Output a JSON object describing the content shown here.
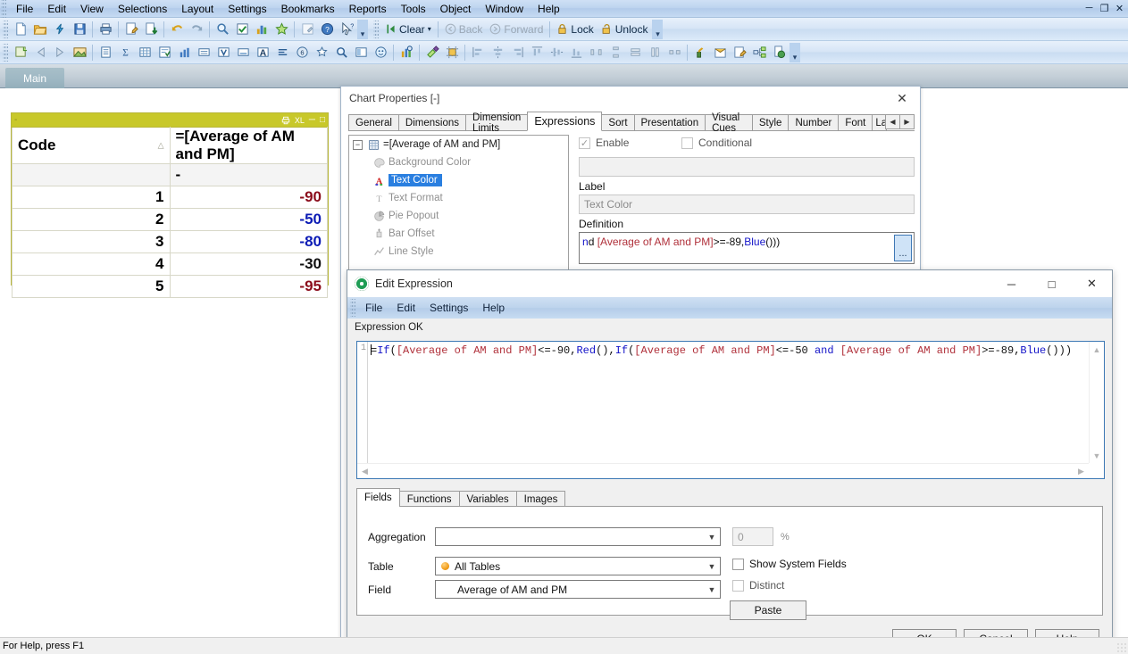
{
  "app": {
    "menu": [
      "File",
      "Edit",
      "View",
      "Selections",
      "Layout",
      "Settings",
      "Bookmarks",
      "Reports",
      "Tools",
      "Object",
      "Window",
      "Help"
    ],
    "window_controls": [
      "minimize-icon",
      "restore-icon",
      "close-icon"
    ],
    "sheet_tab": "Main",
    "status_text": "For Help, press F1",
    "toolbar_nav": {
      "clear": "Clear",
      "back": "Back",
      "forward": "Forward",
      "lock": "Lock",
      "unlock": "Unlock"
    }
  },
  "table_object": {
    "caption_title": "-",
    "caption_icons": [
      "print-icon",
      "XL",
      "minimize-icon",
      "maximize-icon"
    ],
    "columns": [
      "Code",
      "=[Average of AM and PM]"
    ],
    "total_row": [
      "",
      "-"
    ],
    "rows": [
      {
        "code": "1",
        "value": "-90",
        "color": "#8b0c1b"
      },
      {
        "code": "2",
        "value": "-50",
        "color": "#0b1bb5"
      },
      {
        "code": "3",
        "value": "-80",
        "color": "#0b1bb5"
      },
      {
        "code": "4",
        "value": "-30",
        "color": "#111111"
      },
      {
        "code": "5",
        "value": "-95",
        "color": "#8b0c1b"
      }
    ],
    "caption_color": "#c8c82a"
  },
  "chart_properties": {
    "title": "Chart Properties [-]",
    "close_label": "✕",
    "tabs": [
      "General",
      "Dimensions",
      "Dimension Limits",
      "Expressions",
      "Sort",
      "Presentation",
      "Visual Cues",
      "Style",
      "Number",
      "Font",
      "La"
    ],
    "active_tab": "Expressions",
    "spinners": [
      "◀",
      "▶"
    ],
    "tree": {
      "root": "=[Average of AM and PM]",
      "children": [
        "Background Color",
        "Text Color",
        "Text Format",
        "Pie Popout",
        "Bar Offset",
        "Line Style"
      ],
      "selected": "Text Color"
    },
    "enable_label": "Enable",
    "enable_checked": true,
    "conditional_label": "Conditional",
    "conditional_checked": false,
    "conditional_value": "",
    "label_caption": "Label",
    "label_value": "Text Color",
    "definition_caption": "Definition",
    "definition_visible_text": "nd [Average of AM and PM]>=-89,Blue()))",
    "definition_button": "..."
  },
  "edit_expression": {
    "title": "Edit Expression",
    "window_buttons": [
      "minimize-icon",
      "maximize-icon",
      "close-icon"
    ],
    "menu": [
      "File",
      "Edit",
      "Settings",
      "Help"
    ],
    "status": "Expression OK",
    "line_number": "1",
    "expression": "=If([Average of AM and PM]<=-90,Red(),If([Average of AM and PM]<=-50 and [Average of AM and PM]>=-89,Blue()))",
    "expression_tokens": [
      {
        "t": "=",
        "c": "dark"
      },
      {
        "t": "If",
        "c": "blue"
      },
      {
        "t": "(",
        "c": "dark"
      },
      {
        "t": "[Average of AM and PM]",
        "c": "red"
      },
      {
        "t": "<=-90,",
        "c": "dark"
      },
      {
        "t": "Red",
        "c": "blue"
      },
      {
        "t": "(),",
        "c": "dark"
      },
      {
        "t": "If",
        "c": "blue"
      },
      {
        "t": "(",
        "c": "dark"
      },
      {
        "t": "[Average of AM and PM]",
        "c": "red"
      },
      {
        "t": "<=-50 ",
        "c": "dark"
      },
      {
        "t": "and",
        "c": "blue"
      },
      {
        "t": " ",
        "c": "dark"
      },
      {
        "t": "[Average of AM and PM]",
        "c": "red"
      },
      {
        "t": ">=-89,",
        "c": "dark"
      },
      {
        "t": "Blue",
        "c": "blue"
      },
      {
        "t": "()))",
        "c": "dark"
      }
    ],
    "lower_tabs": [
      "Fields",
      "Functions",
      "Variables",
      "Images"
    ],
    "active_lower_tab": "Fields",
    "fields_panel": {
      "aggregation_label": "Aggregation",
      "aggregation_value": "",
      "table_label": "Table",
      "table_value": "All Tables",
      "field_label": "Field",
      "field_value": "Average of AM and PM",
      "percent_value": "0",
      "percent_symbol": "%",
      "show_system_fields_label": "Show System Fields",
      "show_system_fields_checked": false,
      "distinct_label": "Distinct",
      "distinct_checked": false,
      "paste_label": "Paste"
    },
    "buttons": {
      "ok": "OK",
      "cancel": "Cancel",
      "help": "Help"
    }
  }
}
